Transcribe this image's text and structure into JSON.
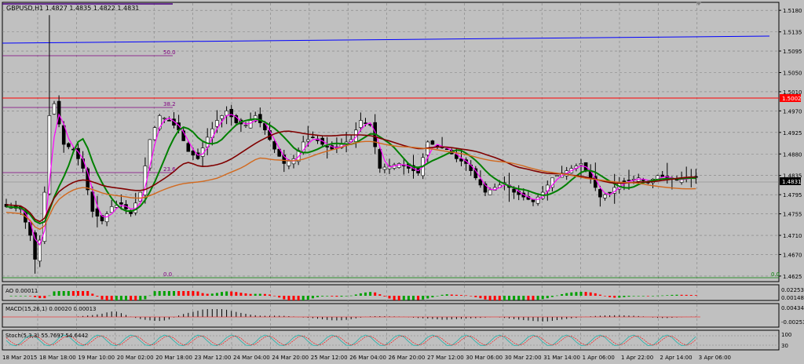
{
  "chart_data": {
    "type": "candlestick",
    "symbol_title": "GBPUSD,H1  1.4827 1.4835 1.4822 1.4831",
    "x_tick_labels": [
      "18 Mar 2015",
      "18 Mar 18:00",
      "19 Mar 10:00",
      "20 Mar 02:00",
      "20 Mar 18:00",
      "23 Mar 12:00",
      "24 Mar 04:00",
      "24 Mar 20:00",
      "25 Mar 12:00",
      "26 Mar 04:00",
      "26 Mar 20:00",
      "27 Mar 12:00",
      "30 Mar 06:00",
      "30 Mar 22:00",
      "31 Mar 14:00",
      "1 Apr 06:00",
      "1 Apr 22:00",
      "2 Apr 14:00",
      "3 Apr 06:00"
    ],
    "y_tick_labels": [
      "1.5180",
      "1.5135",
      "1.5095",
      "1.5050",
      "1.5010",
      "1.4970",
      "1.4925",
      "1.4880",
      "1.4835",
      "1.4795",
      "1.4755",
      "1.4710",
      "1.4670",
      "1.4625"
    ],
    "y_range": [
      1.4615,
      1.5195
    ],
    "current_price": "1.4831",
    "resistance_price": "1.5002",
    "resistance_color": "#ff0000",
    "fib_labels": [
      "50.0",
      "38.2",
      "23.6",
      "0.0"
    ],
    "fib_zero_right_label": "0.0",
    "fib_color": "#800080",
    "close_path": [
      [
        0,
        1.477
      ],
      [
        3,
        1.4765
      ],
      [
        5,
        1.471
      ],
      [
        6,
        1.466
      ],
      [
        7,
        1.47
      ],
      [
        8,
        1.48
      ],
      [
        9,
        1.496
      ],
      [
        10,
        1.4985
      ],
      [
        12,
        1.49
      ],
      [
        14,
        1.489
      ],
      [
        16,
        1.485
      ],
      [
        18,
        1.476
      ],
      [
        20,
        1.474
      ],
      [
        22,
        1.477
      ],
      [
        24,
        1.4775
      ],
      [
        26,
        1.4755
      ],
      [
        28,
        1.48
      ],
      [
        30,
        1.491
      ],
      [
        32,
        1.496
      ],
      [
        34,
        1.495
      ],
      [
        36,
        1.493
      ],
      [
        38,
        1.4885
      ],
      [
        40,
        1.487
      ],
      [
        42,
        1.4915
      ],
      [
        44,
        1.495
      ],
      [
        46,
        1.497
      ],
      [
        48,
        1.4945
      ],
      [
        50,
        1.494
      ],
      [
        52,
        1.496
      ],
      [
        54,
        1.493
      ],
      [
        56,
        1.489
      ],
      [
        58,
        1.486
      ],
      [
        60,
        1.487
      ],
      [
        62,
        1.4905
      ],
      [
        64,
        1.4915
      ],
      [
        66,
        1.49
      ],
      [
        68,
        1.489
      ],
      [
        70,
        1.49
      ],
      [
        72,
        1.491
      ],
      [
        74,
        1.495
      ],
      [
        76,
        1.494
      ],
      [
        78,
        1.485
      ],
      [
        80,
        1.4855
      ],
      [
        82,
        1.486
      ],
      [
        84,
        1.485
      ],
      [
        86,
        1.484
      ],
      [
        88,
        1.4905
      ],
      [
        90,
        1.4895
      ],
      [
        92,
        1.489
      ],
      [
        94,
        1.487
      ],
      [
        96,
        1.486
      ],
      [
        98,
        1.483
      ],
      [
        100,
        1.48
      ],
      [
        102,
        1.481
      ],
      [
        104,
        1.482
      ],
      [
        106,
        1.48
      ],
      [
        108,
        1.479
      ],
      [
        110,
        1.478
      ],
      [
        112,
        1.48
      ],
      [
        114,
        1.483
      ],
      [
        116,
        1.484
      ],
      [
        118,
        1.485
      ],
      [
        120,
        1.486
      ],
      [
        122,
        1.483
      ],
      [
        124,
        1.479
      ],
      [
        126,
        1.48
      ],
      [
        128,
        1.482
      ],
      [
        130,
        1.4825
      ],
      [
        132,
        1.483
      ],
      [
        134,
        1.482
      ],
      [
        136,
        1.4835
      ],
      [
        138,
        1.483
      ],
      [
        140,
        1.4825
      ],
      [
        142,
        1.483
      ],
      [
        144,
        1.4831
      ]
    ],
    "indicators": {
      "ao": {
        "label": "AO 0.00011",
        "tick_labels": [
          "0.02253",
          "0.00148"
        ]
      },
      "macd": {
        "label": "MACD(15,26,1) 0.00020 0.00013",
        "tick_labels": [
          "0.00434",
          "-0.00253"
        ]
      },
      "stoch": {
        "label": "Stoch(5,3,3) 55.7697 54.6442",
        "tick_labels": [
          "100",
          "30"
        ]
      }
    },
    "colors": {
      "bull_candle": "#ffffff",
      "bear_candle": "#000000",
      "ma_fast": "#ff00ff",
      "ma_green": "#008000",
      "ma_brown": "#800000",
      "ma_orange": "#d2691e",
      "trend_blue": "#0000ff",
      "ao_up": "#00a000",
      "ao_down": "#ff0000"
    }
  }
}
